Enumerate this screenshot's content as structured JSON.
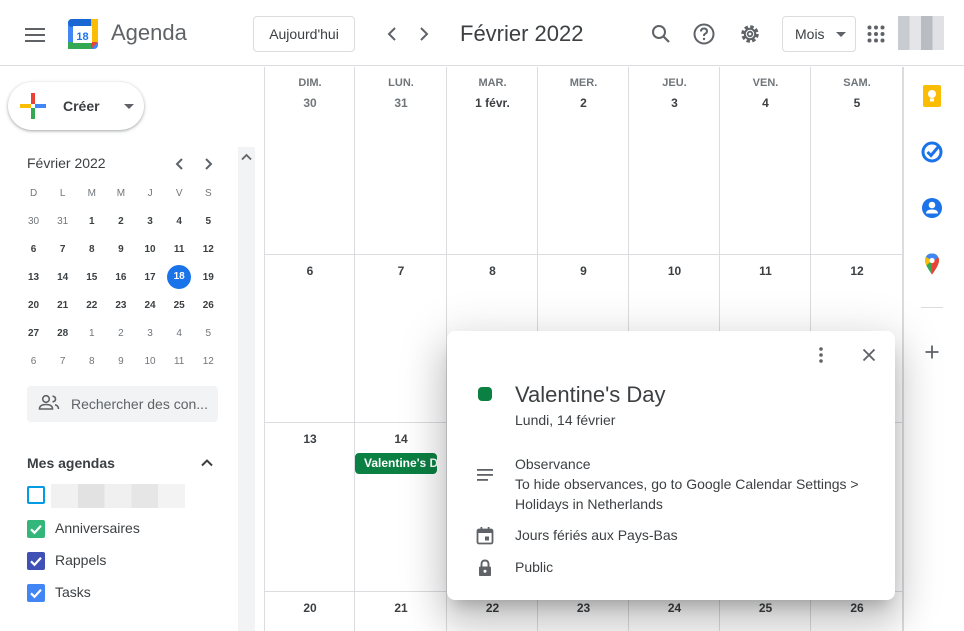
{
  "header": {
    "app_title": "Agenda",
    "logo_day": "18",
    "today_label": "Aujourd'hui",
    "month_title": "Février 2022",
    "view_label": "Mois"
  },
  "sidebar": {
    "create_label": "Créer",
    "mini_title": "Février 2022",
    "dow": [
      "D",
      "L",
      "M",
      "M",
      "J",
      "V",
      "S"
    ],
    "weeks": [
      [
        {
          "d": "30",
          "o": true
        },
        {
          "d": "31",
          "o": true
        },
        {
          "d": "1"
        },
        {
          "d": "2"
        },
        {
          "d": "3"
        },
        {
          "d": "4"
        },
        {
          "d": "5"
        }
      ],
      [
        {
          "d": "6"
        },
        {
          "d": "7"
        },
        {
          "d": "8"
        },
        {
          "d": "9"
        },
        {
          "d": "10"
        },
        {
          "d": "11"
        },
        {
          "d": "12"
        }
      ],
      [
        {
          "d": "13"
        },
        {
          "d": "14"
        },
        {
          "d": "15"
        },
        {
          "d": "16"
        },
        {
          "d": "17"
        },
        {
          "d": "18",
          "t": true
        },
        {
          "d": "19"
        }
      ],
      [
        {
          "d": "20"
        },
        {
          "d": "21"
        },
        {
          "d": "22"
        },
        {
          "d": "23"
        },
        {
          "d": "24"
        },
        {
          "d": "25"
        },
        {
          "d": "26"
        }
      ],
      [
        {
          "d": "27"
        },
        {
          "d": "28"
        },
        {
          "d": "1",
          "o": true
        },
        {
          "d": "2",
          "o": true
        },
        {
          "d": "3",
          "o": true
        },
        {
          "d": "4",
          "o": true
        },
        {
          "d": "5",
          "o": true
        }
      ],
      [
        {
          "d": "6",
          "o": true
        },
        {
          "d": "7",
          "o": true
        },
        {
          "d": "8",
          "o": true
        },
        {
          "d": "9",
          "o": true
        },
        {
          "d": "10",
          "o": true
        },
        {
          "d": "11",
          "o": true
        },
        {
          "d": "12",
          "o": true
        }
      ]
    ],
    "search_people_placeholder": "Rechercher des con...",
    "my_calendars_title": "Mes agendas",
    "calendars": [
      {
        "name": "",
        "color": "#039be5",
        "checked": false
      },
      {
        "name": "Anniversaires",
        "color": "#33b679",
        "checked": true
      },
      {
        "name": "Rappels",
        "color": "#3f51b5",
        "checked": true
      },
      {
        "name": "Tasks",
        "color": "#4285f4",
        "checked": true
      }
    ]
  },
  "month": {
    "dow": [
      "DIM.",
      "LUN.",
      "MAR.",
      "MER.",
      "JEU.",
      "VEN.",
      "SAM."
    ],
    "weeks": [
      [
        {
          "d": "30",
          "o": true
        },
        {
          "d": "31",
          "o": true
        },
        {
          "d": "1 févr."
        },
        {
          "d": "2"
        },
        {
          "d": "3"
        },
        {
          "d": "4"
        },
        {
          "d": "5"
        }
      ],
      [
        {
          "d": "6"
        },
        {
          "d": "7"
        },
        {
          "d": "8"
        },
        {
          "d": "9"
        },
        {
          "d": "10"
        },
        {
          "d": "11"
        },
        {
          "d": "12"
        }
      ],
      [
        {
          "d": "13"
        },
        {
          "d": "14"
        },
        {
          "d": ""
        },
        {
          "d": ""
        },
        {
          "d": ""
        },
        {
          "d": ""
        },
        {
          "d": ""
        }
      ],
      [
        {
          "d": "20"
        },
        {
          "d": "21"
        },
        {
          "d": "22"
        },
        {
          "d": "23"
        },
        {
          "d": "24"
        },
        {
          "d": "25"
        },
        {
          "d": "26"
        }
      ]
    ],
    "event_chip": "Valentine's D"
  },
  "popup": {
    "title": "Valentine's Day",
    "date": "Lundi, 14 février",
    "description_title": "Observance",
    "description_body": "To hide observances, go to Google Calendar Settings > Holidays in Netherlands",
    "calendar_name": "Jours fériés aux Pays-Bas",
    "visibility": "Public",
    "event_color": "#0b8043"
  },
  "colors": {
    "accent": "#1a73e8",
    "event_green": "#0b8043"
  }
}
